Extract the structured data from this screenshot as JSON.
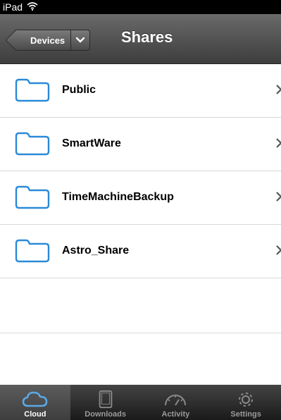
{
  "status_bar": {
    "device": "iPad"
  },
  "nav": {
    "back_label": "Devices",
    "title": "Shares"
  },
  "shares": [
    {
      "name": "Public"
    },
    {
      "name": "SmartWare"
    },
    {
      "name": "TimeMachineBackup"
    },
    {
      "name": "Astro_Share"
    }
  ],
  "tabs": [
    {
      "label": "Cloud",
      "icon": "cloud-icon",
      "active": true
    },
    {
      "label": "Downloads",
      "icon": "tablet-icon",
      "active": false
    },
    {
      "label": "Activity",
      "icon": "speedometer-icon",
      "active": false
    },
    {
      "label": "Settings",
      "icon": "gear-icon",
      "active": false
    }
  ],
  "colors": {
    "folder": "#2a8ad8",
    "navbar": "#4a4a4a",
    "tab_active_icon": "#5aa9e6"
  }
}
